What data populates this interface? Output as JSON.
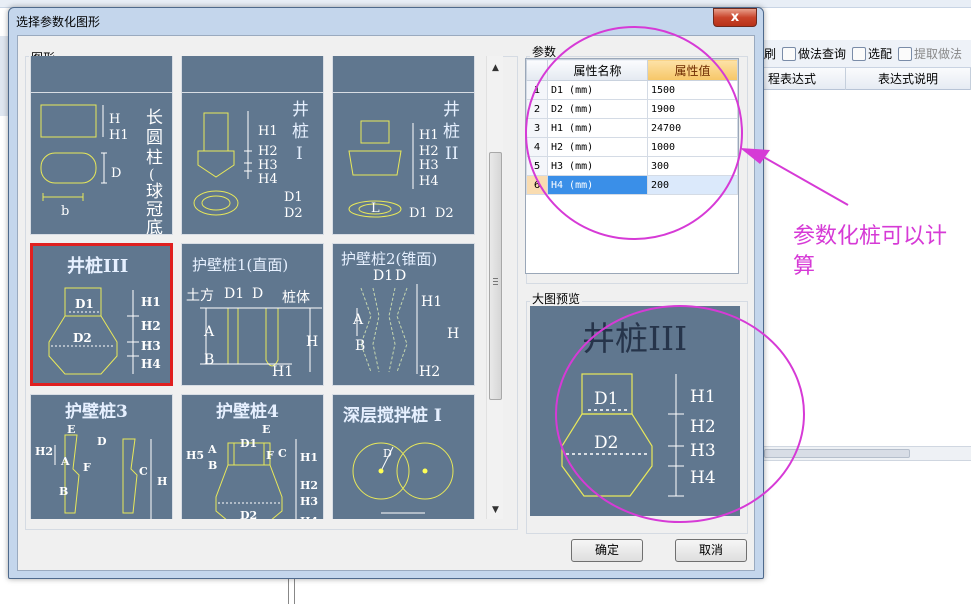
{
  "background": {
    "toolbar": [
      {
        "label": "刷",
        "icon": "refresh-icon",
        "dim": false
      },
      {
        "label": "做法查询",
        "icon": "document-search-icon",
        "dim": false
      },
      {
        "label": "选配",
        "icon": "select-config-icon",
        "dim": false
      },
      {
        "label": "提取做法",
        "icon": "extract-icon",
        "dim": true
      }
    ],
    "grid_headers": [
      "程表达式",
      "表达式说明"
    ]
  },
  "dialog": {
    "title": "选择参数化图形",
    "close_label": "x",
    "figures_group_label": "图形",
    "params_group_label": "参数",
    "preview_group_label": "大图预览",
    "ok_label": "确定",
    "cancel_label": "取消"
  },
  "params": {
    "headers": {
      "name": "属性名称",
      "value": "属性值"
    },
    "rows": [
      {
        "index": "1",
        "name": "D1 (mm)",
        "value": "1500"
      },
      {
        "index": "2",
        "name": "D2 (mm)",
        "value": "1900"
      },
      {
        "index": "3",
        "name": "H1 (mm)",
        "value": "24700"
      },
      {
        "index": "4",
        "name": "H2 (mm)",
        "value": "1000"
      },
      {
        "index": "5",
        "name": "H3 (mm)",
        "value": "300"
      },
      {
        "index": "6",
        "name": "H4 (mm)",
        "value": "200"
      }
    ],
    "selected_row": 6
  },
  "figures": {
    "tiles": [
      {
        "name": "长圆柱(球冠底)",
        "labels": [
          "长",
          "圆",
          "柱",
          "(",
          "球",
          "冠",
          "底",
          ")",
          "H",
          "H1",
          "D",
          "b"
        ]
      },
      {
        "name": "井桩I",
        "labels": [
          "井",
          "桩",
          "I",
          "H1",
          "H2",
          "H3",
          "H4",
          "D1",
          "D2"
        ]
      },
      {
        "name": "井桩II",
        "labels": [
          "井",
          "桩",
          "II",
          "H1",
          "H2",
          "H3",
          "H4",
          "L",
          "D1",
          "D2"
        ]
      },
      {
        "name": "井桩III",
        "labels": [
          "井桩III",
          "D1",
          "D2",
          "H1",
          "H2",
          "H3",
          "H4"
        ],
        "selected": true
      },
      {
        "name": "护壁桩1(直面)",
        "labels": [
          "护壁桩1(直面)",
          "土方",
          "D1",
          "D",
          "桩体",
          "A",
          "B",
          "H",
          "H1"
        ]
      },
      {
        "name": "护壁桩2(锥面)",
        "labels": [
          "护壁桩2(锥面)",
          "D1",
          "D",
          "A",
          "B",
          "H1",
          "H",
          "H2"
        ]
      },
      {
        "name": "护壁桩3",
        "labels": [
          "护壁桩3",
          "E",
          "D",
          "H2",
          "A",
          "F",
          "B",
          "C",
          "H"
        ]
      },
      {
        "name": "护壁桩4",
        "labels": [
          "护壁桩4",
          "E",
          "D1",
          "H5",
          "A",
          "B",
          "F",
          "C",
          "H1",
          "H2",
          "H3",
          "H4",
          "D2"
        ]
      },
      {
        "name": "深层搅拌桩I",
        "labels": [
          "深层搅拌桩 I",
          "D"
        ]
      }
    ]
  },
  "preview": {
    "title": "井桩III",
    "labels": {
      "d1": "D1",
      "d2": "D2",
      "h1": "H1",
      "h2": "H2",
      "h3": "H3",
      "h4": "H4"
    }
  },
  "annotation": {
    "text": "参数化桩可以计算",
    "color": "#d63ad6"
  }
}
